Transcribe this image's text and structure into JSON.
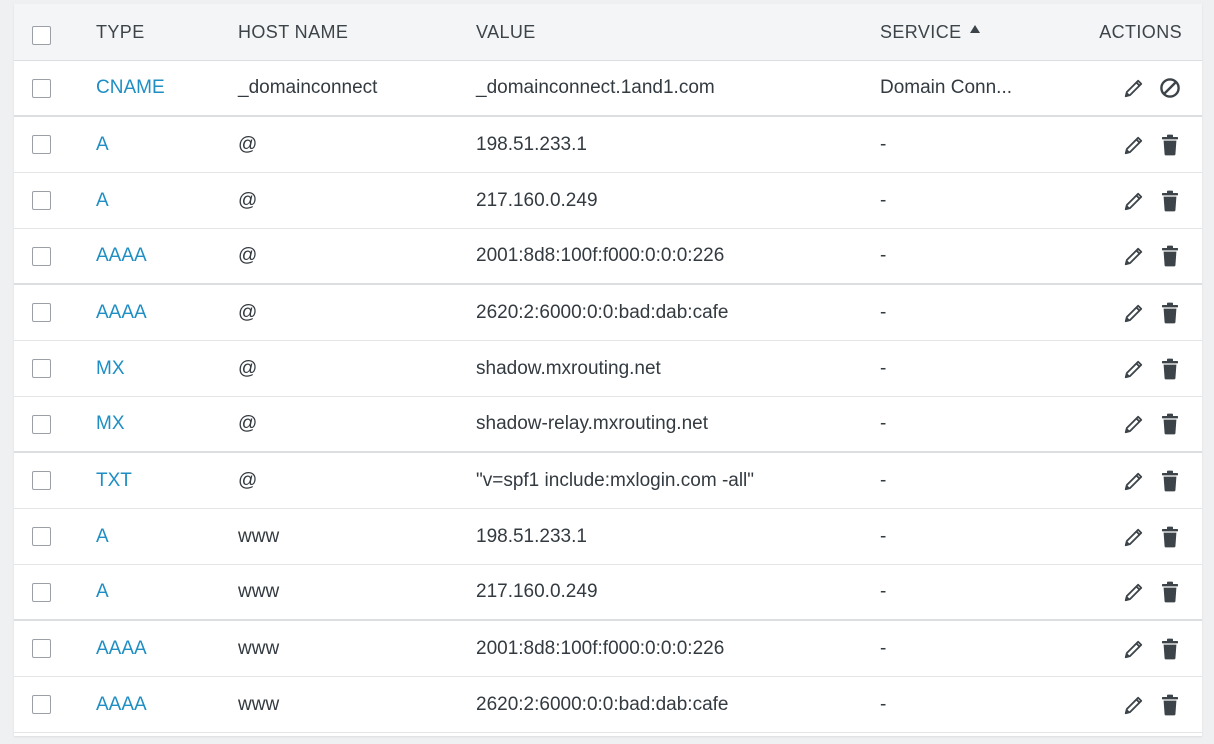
{
  "header": {
    "type": "TYPE",
    "host": "HOST NAME",
    "value": "VALUE",
    "service": "SERVICE",
    "actions": "ACTIONS"
  },
  "rows": [
    {
      "type": "CNAME",
      "host": "_domainconnect",
      "value": "_domainconnect.1and1.com",
      "service": "Domain Conn...",
      "second_action": "disable-icon"
    },
    {
      "type": "A",
      "host": "@",
      "value": "198.51.233.1",
      "service": "-",
      "second_action": "trash-icon"
    },
    {
      "type": "A",
      "host": "@",
      "value": "217.160.0.249",
      "service": "-",
      "second_action": "trash-icon"
    },
    {
      "type": "AAAA",
      "host": "@",
      "value": "2001:8d8:100f:f000:0:0:0:226",
      "service": "-",
      "second_action": "trash-icon"
    },
    {
      "type": "AAAA",
      "host": "@",
      "value": "2620:2:6000:0:0:bad:dab:cafe",
      "service": "-",
      "second_action": "trash-icon"
    },
    {
      "type": "MX",
      "host": "@",
      "value": "shadow.mxrouting.net",
      "service": "-",
      "second_action": "trash-icon"
    },
    {
      "type": "MX",
      "host": "@",
      "value": "shadow-relay.mxrouting.net",
      "service": "-",
      "second_action": "trash-icon"
    },
    {
      "type": "TXT",
      "host": "@",
      "value": "\"v=spf1 include:mxlogin.com -all\"",
      "service": "-",
      "second_action": "trash-icon"
    },
    {
      "type": "A",
      "host": "www",
      "value": "198.51.233.1",
      "service": "-",
      "second_action": "trash-icon"
    },
    {
      "type": "A",
      "host": "www",
      "value": "217.160.0.249",
      "service": "-",
      "second_action": "trash-icon"
    },
    {
      "type": "AAAA",
      "host": "www",
      "value": "2001:8d8:100f:f000:0:0:0:226",
      "service": "-",
      "second_action": "trash-icon"
    },
    {
      "type": "AAAA",
      "host": "www",
      "value": "2620:2:6000:0:0:bad:dab:cafe",
      "service": "-",
      "second_action": "trash-icon"
    }
  ],
  "colors": {
    "link": "#1e8ec4",
    "text": "#333a40",
    "header_bg": "#f4f5f6",
    "icon": "#3d4449"
  }
}
